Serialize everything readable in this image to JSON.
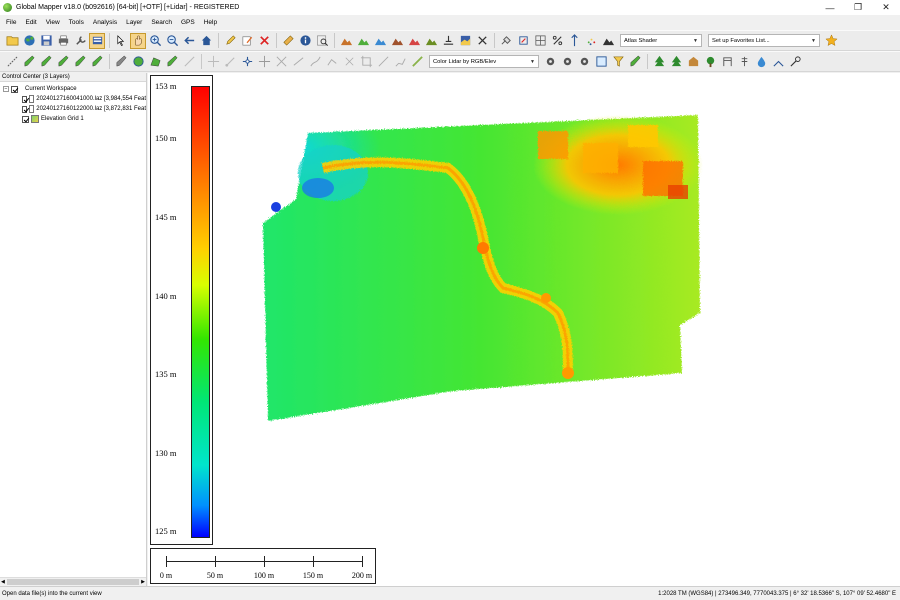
{
  "window": {
    "title": "Global Mapper v18.0 (b092616) [64-bit] [+OTF] [+Lidar] - REGISTERED",
    "controls": {
      "minimize": "—",
      "restore": "❐",
      "close": "✕"
    }
  },
  "menu": [
    "File",
    "Edit",
    "View",
    "Tools",
    "Analysis",
    "Layer",
    "Search",
    "GPS",
    "Help"
  ],
  "toolbar": {
    "shader_combo": "Atlas Shader",
    "favorites_combo": "Set up Favorites List...",
    "lidar_color_combo": "Color Lidar by RGB/Elev"
  },
  "control_center": {
    "title": "Control Center (3 Layers)",
    "workspace": "Current Workspace",
    "layers": [
      {
        "name": "20240127160041000.laz [3,984,554 Feat",
        "type": "lidar"
      },
      {
        "name": "20240127160122000.laz [3,872,831 Feat",
        "type": "lidar"
      },
      {
        "name": "Elevation Grid 1",
        "type": "grid"
      }
    ],
    "expander": "−",
    "scroll_left": "◀",
    "scroll_right": "▶"
  },
  "map": {
    "legend": {
      "unit": "m",
      "ticks": [
        "153 m",
        "150 m",
        "145 m",
        "140 m",
        "135 m",
        "130 m",
        "125 m"
      ],
      "max": 153,
      "min": 124.5,
      "colors": [
        "#ff0000",
        "#ff6a00",
        "#ffd000",
        "#d8ff00",
        "#33e600",
        "#00e676",
        "#00e5cc",
        "#0090ff",
        "#0000ff"
      ]
    },
    "scalebar": {
      "labels": [
        "0 m",
        "50 m",
        "100 m",
        "150 m",
        "200 m"
      ]
    }
  },
  "status": {
    "left": "Open data file(s) into the current view",
    "right": "1:2028  TM (WGS84) | 273496.349, 7770043.375 | 6° 32' 18.5366\" S, 107° 09' 52.4680\" E"
  }
}
